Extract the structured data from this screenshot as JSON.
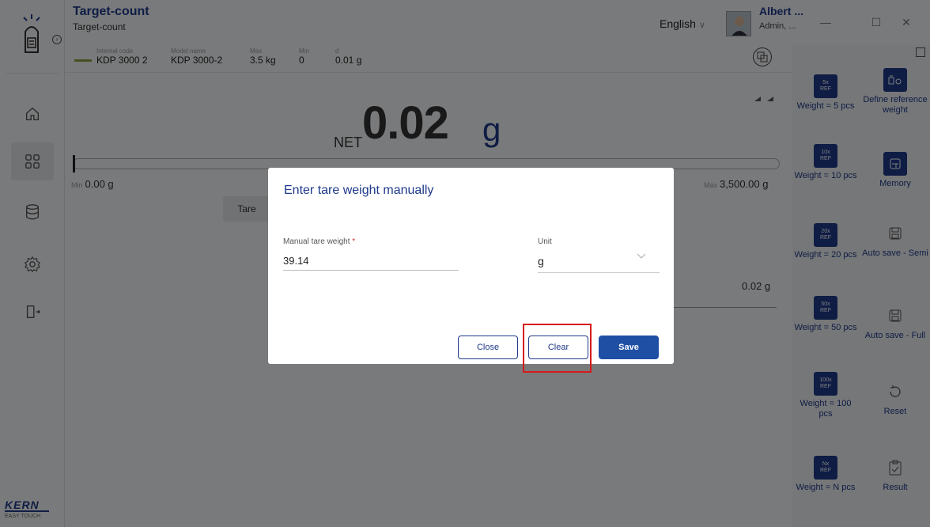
{
  "header": {
    "app_title": "Target-count",
    "app_subtitle": "Target-count",
    "language": "English",
    "user_name": "Albert ...",
    "user_role": "Admin, ..."
  },
  "infobar": {
    "internal_code_label": "Internal code",
    "internal_code": "KDP 3000 2",
    "model_name_label": "Model name",
    "model_name": "KDP 3000-2",
    "max_label": "Max",
    "max": "3.5 kg",
    "min_label": "Min",
    "min": "0",
    "d_label": "d",
    "d": "0.01 g"
  },
  "reading": {
    "net_label": "NET",
    "value": "0.02",
    "unit": "g",
    "min_label": "Min",
    "min_value": "0.00 g",
    "max_label": "Max",
    "max_value": "3,500.00 g",
    "tare_button": "Tare",
    "result_value": "0.02 g"
  },
  "right_panel": {
    "items": [
      {
        "icon_text": "5x\nREF",
        "label": "Weight = 5 pcs"
      },
      {
        "icon_text": "",
        "label": "Define reference weight"
      },
      {
        "icon_text": "10x\nREF",
        "label": "Weight = 10 pcs"
      },
      {
        "icon_text": "",
        "label": "Memory"
      },
      {
        "icon_text": "20x\nREF",
        "label": "Weight = 20 pcs"
      },
      {
        "icon_text": "",
        "label": "Auto save - Semi"
      },
      {
        "icon_text": "50x\nREF",
        "label": "Weight = 50 pcs"
      },
      {
        "icon_text": "",
        "label": "Auto save - Full"
      },
      {
        "icon_text": "100x\nREF",
        "label": "Weight = 100 pcs"
      },
      {
        "icon_text": "",
        "label": "Reset"
      },
      {
        "icon_text": "Nx\nREF",
        "label": "Weight = N pcs"
      },
      {
        "icon_text": "",
        "label": "Result"
      }
    ]
  },
  "dialog": {
    "title": "Enter tare weight manually",
    "tare_label": "Manual tare weight",
    "tare_required": "*",
    "tare_value": "39.14",
    "unit_label": "Unit",
    "unit_value": "g",
    "close_label": "Close",
    "clear_label": "Clear",
    "save_label": "Save"
  },
  "branding": {
    "logo": "KERN",
    "logo_sub": "EASY TOUCH"
  },
  "colors": {
    "accent": "#1f3a8a",
    "highlight": "#d61a1a"
  }
}
